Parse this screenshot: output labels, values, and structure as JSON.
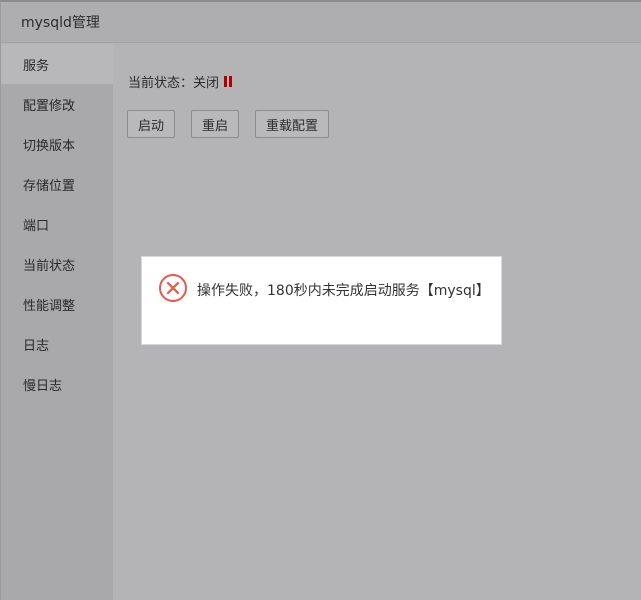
{
  "window": {
    "title": "mysqld管理"
  },
  "sidebar": {
    "items": [
      {
        "label": "服务",
        "active": true
      },
      {
        "label": "配置修改"
      },
      {
        "label": "切换版本"
      },
      {
        "label": "存储位置"
      },
      {
        "label": "端口"
      },
      {
        "label": "当前状态"
      },
      {
        "label": "性能调整"
      },
      {
        "label": "日志"
      },
      {
        "label": "慢日志"
      }
    ]
  },
  "main": {
    "status_label": "当前状态：关闭",
    "status_color": "#b00000",
    "buttons": {
      "start": "启动",
      "restart": "重启",
      "reload": "重载配置"
    }
  },
  "dialog": {
    "icon": "error-circle-x-icon",
    "message": "操作失败，180秒内未完成启动服务【mysql】"
  }
}
